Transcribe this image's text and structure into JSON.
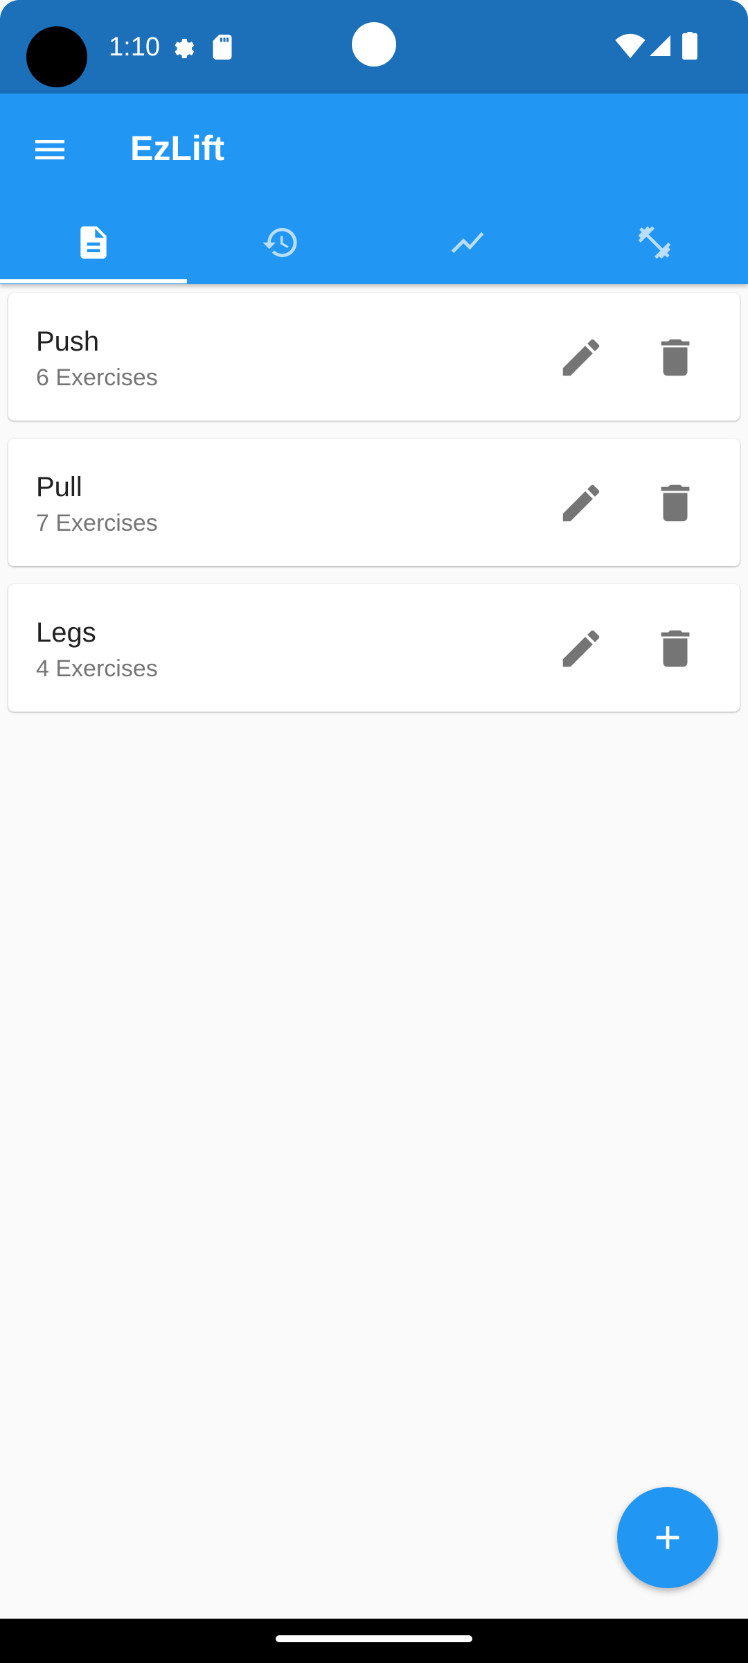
{
  "status_bar": {
    "time": "1:10",
    "icons": [
      "settings-icon",
      "sd-card-icon",
      "wifi-icon",
      "signal-icon",
      "battery-icon"
    ]
  },
  "app_bar": {
    "title": "EzLift",
    "menu_icon": "menu-icon"
  },
  "tabs": [
    {
      "icon": "document-icon",
      "selected": true
    },
    {
      "icon": "history-icon",
      "selected": false
    },
    {
      "icon": "trending-icon",
      "selected": false
    },
    {
      "icon": "dumbbell-icon",
      "selected": false
    }
  ],
  "workouts": [
    {
      "name": "Push",
      "subtitle": "6 Exercises"
    },
    {
      "name": "Pull",
      "subtitle": "7 Exercises"
    },
    {
      "name": "Legs",
      "subtitle": "4 Exercises"
    }
  ],
  "fab": {
    "icon": "add-icon"
  },
  "colors": {
    "primary": "#2196f3",
    "status_bar": "#1b70b9",
    "background": "#fafafa",
    "icon_gray": "#757575"
  }
}
